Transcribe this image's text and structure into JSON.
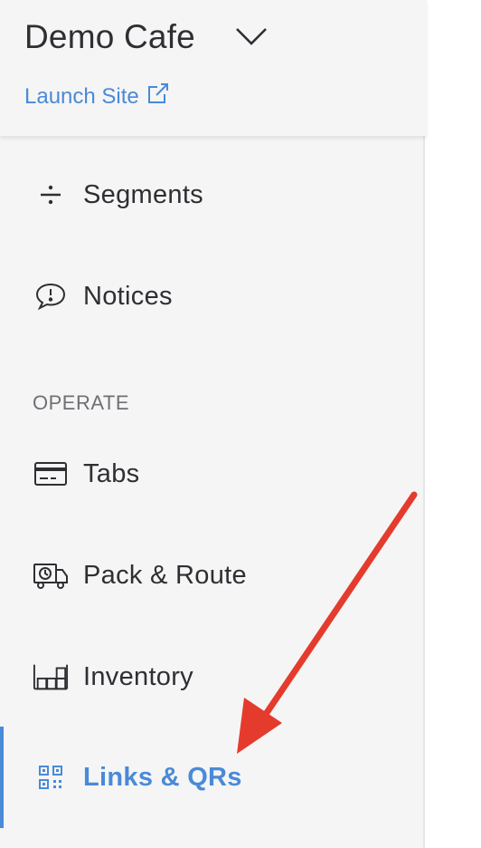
{
  "brand": {
    "name": "Demo Cafe",
    "launch_label": "Launch Site"
  },
  "nav": {
    "segments": "Segments",
    "notices": "Notices",
    "operate_section": "OPERATE",
    "tabs": "Tabs",
    "pack_route": "Pack & Route",
    "inventory": "Inventory",
    "links_qrs": "Links & QRs"
  },
  "colors": {
    "accent": "#4a8ad6",
    "annotation_arrow": "#e53b2c",
    "sidebar_bg": "#f5f5f6"
  }
}
